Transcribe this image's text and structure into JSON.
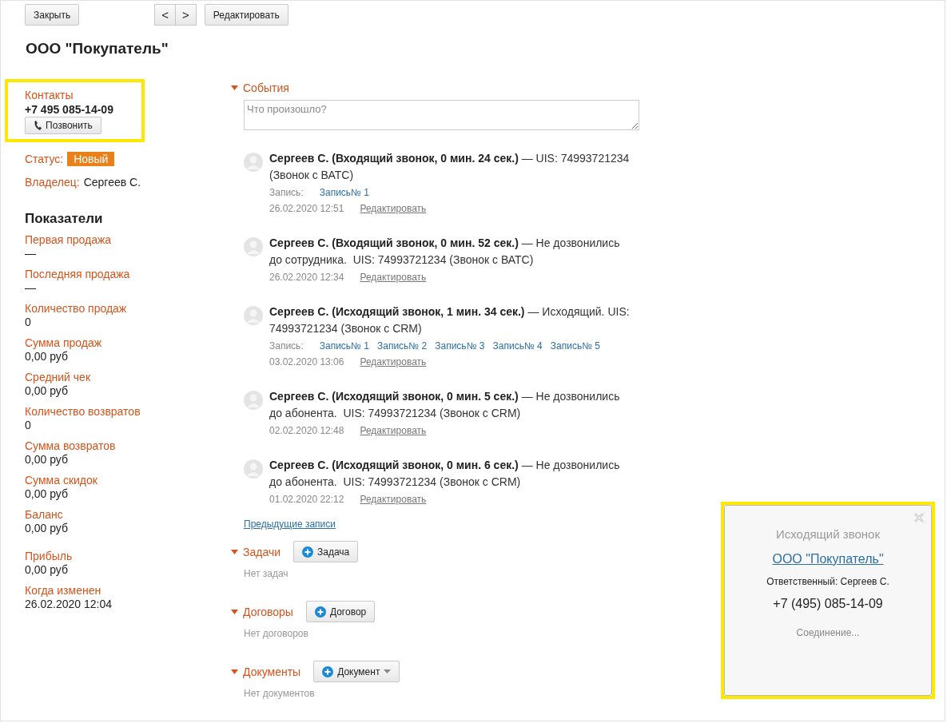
{
  "toolbar": {
    "close": "Закрыть",
    "prev": "<",
    "next": ">",
    "edit": "Редактировать"
  },
  "title": "ООО \"Покупатель\"",
  "contacts": {
    "label": "Контакты",
    "phone": "+7 495 085-14-09",
    "call_button": "Позвонить",
    "highlighted": true
  },
  "status": {
    "label": "Статус:",
    "value": "Новый"
  },
  "owner": {
    "label": "Владелец:",
    "value": "Сергеев С."
  },
  "metrics_title": "Показатели",
  "metrics": [
    {
      "label": "Первая продажа",
      "value": "—"
    },
    {
      "label": "Последняя продажа",
      "value": "—"
    },
    {
      "label": "Количество продаж",
      "value": "0"
    },
    {
      "label": "Сумма продаж",
      "value": "0,00 руб"
    },
    {
      "label": "Средний чек",
      "value": "0,00 руб"
    },
    {
      "label": "Количество возвратов",
      "value": "0"
    },
    {
      "label": "Сумма возвратов",
      "value": "0,00 руб"
    },
    {
      "label": "Сумма скидок",
      "value": "0,00 руб"
    },
    {
      "label": "Баланс",
      "value": "0,00 руб"
    }
  ],
  "metrics_extra": [
    {
      "label": "Прибыль",
      "value": "0,00 руб"
    },
    {
      "label": "Когда изменен",
      "value": "26.02.2020 12:04"
    }
  ],
  "events": {
    "title": "События",
    "expanded": true,
    "placeholder": "Что произошло?",
    "items": [
      {
        "text": "**Сергеев С. (Входящий звонок, 0 мин. 24 сек.)** — UIS: 74993721234 (Звонок с ВАТС)",
        "records_label": "Запись:",
        "records": [
          "Запись№ 1"
        ],
        "date": "26.02.2020 12:51",
        "edit": "Редактировать"
      },
      {
        "text": "**Сергеев С. (Входящий звонок, 0 мин. 52 сек.)** — Не дозвонились до сотрудника.  UIS: 74993721234 (Звонок с ВАТС)",
        "date": "26.02.2020 12:34",
        "edit": "Редактировать"
      },
      {
        "text": "**Сергеев С. (Исходящий звонок, 1 мин. 34 сек.)** — Исходящий. UIS: 74993721234 (Звонок с CRM)",
        "records_label": "Запись:",
        "records": [
          "Запись№ 1",
          "Запись№ 2",
          "Запись№ 3",
          "Запись№ 4",
          "Запись№ 5"
        ],
        "date": "03.02.2020 13:06",
        "edit": "Редактировать"
      },
      {
        "text": "**Сергеев С. (Исходящий звонок, 0 мин. 5 сек.)** — Не дозвонились до абонента.  UIS: 74993721234 (Звонок с CRM)",
        "date": "02.02.2020 12:48",
        "edit": "Редактировать"
      },
      {
        "text": "**Сергеев С. (Исходящий звонок, 0 мин. 6 сек.)** — Не дозвонились до абонента.  UIS: 74993721234 (Звонок с CRM)",
        "date": "01.02.2020 22:12",
        "edit": "Редактировать"
      }
    ],
    "more": "Предыдущие записи"
  },
  "sections": [
    {
      "title": "Задачи",
      "expanded": true,
      "button": "Задача",
      "has_menu": false,
      "empty": "Нет задач"
    },
    {
      "title": "Договоры",
      "expanded": true,
      "button": "Договор",
      "has_menu": false,
      "empty": "Нет договоров"
    },
    {
      "title": "Документы",
      "expanded": true,
      "button": "Документ",
      "has_menu": true,
      "empty": "Нет документов"
    }
  ],
  "call_popup": {
    "title": "Исходящий звонок",
    "company": "ООО \"Покупатель\"",
    "responsible": "Ответственный: Сергеев С.",
    "phone": "+7 (495) 085-14-09",
    "state": "Соединение...",
    "highlighted": true
  }
}
